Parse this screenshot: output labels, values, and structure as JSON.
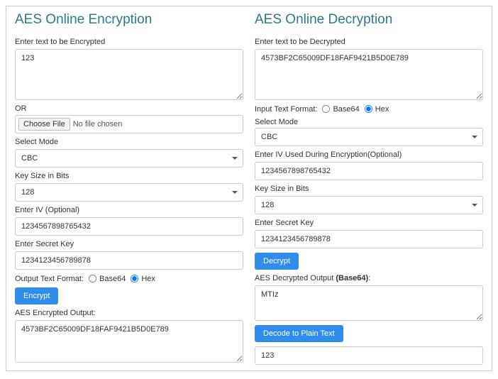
{
  "encryption": {
    "title": "AES Online Encryption",
    "input_label": "Enter text to be Encrypted",
    "input_value": "123",
    "or_label": "OR",
    "choose_file_label": "Choose File",
    "no_file_text": "No file chosen",
    "mode_label": "Select Mode",
    "mode_value": "CBC",
    "keysize_label": "Key Size in Bits",
    "keysize_value": "128",
    "iv_label": "Enter IV (Optional)",
    "iv_value": "1234567898765432",
    "secret_label": "Enter Secret Key",
    "secret_value": "1234123456789878",
    "output_format_label": "Output Text Format:",
    "base64_label": "Base64",
    "hex_label": "Hex",
    "encrypt_button": "Encrypt",
    "output_label": "AES Encrypted Output:",
    "output_value": "4573BF2C65009DF18FAF9421B5D0E789"
  },
  "decryption": {
    "title": "AES Online Decryption",
    "input_label": "Enter text to be Decrypted",
    "input_value": "4573BF2C65009DF18FAF9421B5D0E789",
    "input_format_label": "Input Text Format:",
    "base64_label": "Base64",
    "hex_label": "Hex",
    "mode_label": "Select Mode",
    "mode_value": "CBC",
    "iv_label": "Enter IV Used During Encryption(Optional)",
    "iv_value": "1234567898765432",
    "keysize_label": "Key Size in Bits",
    "keysize_value": "128",
    "secret_label": "Enter Secret Key",
    "secret_value": "1234123456789878",
    "decrypt_button": "Decrypt",
    "output_label_prefix": "AES Decrypted Output ",
    "output_label_bold": "(Base64)",
    "output_label_suffix": ":",
    "output_value": "MTIz",
    "decode_button": "Decode to Plain Text",
    "plain_value": "123"
  }
}
